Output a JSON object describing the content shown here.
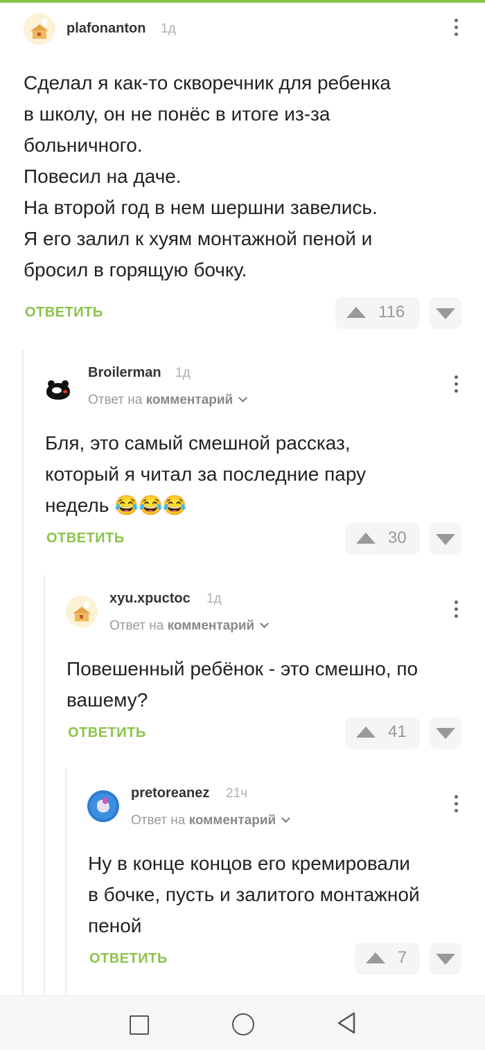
{
  "comments": [
    {
      "username": "plafonanton",
      "time": "1д",
      "text_lines": [
        "Сделал я как-то скворечник для ребенка",
        "в школу, он не понёс в итоге из-за",
        "больничного.",
        "Повесил на даче.",
        "На второй год в нем шершни завелись.",
        "Я его залил к хуям монтажной пеной и",
        "бросил в горящую бочку."
      ],
      "reply_label": "ОТВЕТИТЬ",
      "votes": "116",
      "avatar": "cottage-avatar"
    },
    {
      "username": "Broilerman",
      "time": "1д",
      "reply_prefix": "Ответ на",
      "reply_target": "комментарий",
      "text_lines": [
        "Бля, это самый смешной рассказ,",
        "который я читал за последние пару",
        "недель 😂😂😂"
      ],
      "reply_label": "ОТВЕТИТЬ",
      "votes": "30",
      "avatar": "bear-avatar"
    },
    {
      "username": "xyu.xpuctoc",
      "time": "1д",
      "reply_prefix": "Ответ на",
      "reply_target": "комментарий",
      "text_lines": [
        "Повешенный ребёнок - это смешно, по",
        "вашему?"
      ],
      "reply_label": "ОТВЕТИТЬ",
      "votes": "41",
      "avatar": "cottage-avatar"
    },
    {
      "username": "pretoreanez",
      "time": "21ч",
      "reply_prefix": "Ответ на",
      "reply_target": "комментарий",
      "text_lines": [
        "Ну в конце концов его кремировали",
        "в бочке, пусть и залитого монтажной",
        "пеной"
      ],
      "reply_label": "ОТВЕТИТЬ",
      "votes": "7",
      "avatar": "pony-avatar"
    }
  ],
  "colors": {
    "accent": "#8bc34a",
    "vote_bg": "#f5f5f5",
    "muted": "#999999"
  },
  "navbar": {
    "icons": [
      "recent-apps-icon",
      "home-icon",
      "back-icon"
    ]
  }
}
